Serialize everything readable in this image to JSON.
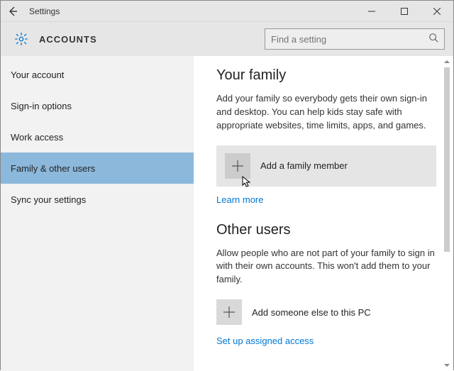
{
  "window": {
    "title": "Settings"
  },
  "header": {
    "section": "ACCOUNTS",
    "search_placeholder": "Find a setting"
  },
  "sidebar": {
    "items": [
      {
        "label": "Your account"
      },
      {
        "label": "Sign-in options"
      },
      {
        "label": "Work access"
      },
      {
        "label": "Family & other users"
      },
      {
        "label": "Sync your settings"
      }
    ],
    "selected_index": 3
  },
  "main": {
    "family": {
      "heading": "Your family",
      "description": "Add your family so everybody gets their own sign-in and desktop. You can help kids stay safe with appropriate websites, time limits, apps, and games.",
      "add_label": "Add a family member",
      "learn_more": "Learn more"
    },
    "other": {
      "heading": "Other users",
      "description": "Allow people who are not part of your family to sign in with their own accounts. This won't add them to your family.",
      "add_label": "Add someone else to this PC",
      "assigned_access": "Set up assigned access"
    }
  }
}
